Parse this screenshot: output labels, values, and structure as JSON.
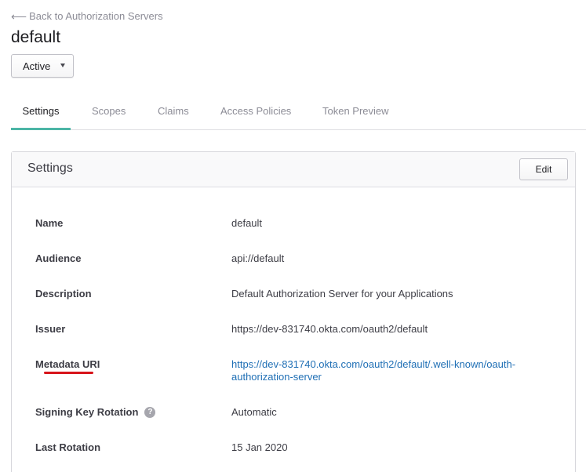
{
  "nav": {
    "back_arrow": "⟵",
    "back_label": "Back to Authorization Servers"
  },
  "page": {
    "title": "default"
  },
  "status": {
    "selected": "Active"
  },
  "tabs": [
    {
      "label": "Settings",
      "active": true
    },
    {
      "label": "Scopes",
      "active": false
    },
    {
      "label": "Claims",
      "active": false
    },
    {
      "label": "Access Policies",
      "active": false
    },
    {
      "label": "Token Preview",
      "active": false
    }
  ],
  "panel": {
    "title": "Settings",
    "edit_label": "Edit"
  },
  "fields": [
    {
      "label": "Name",
      "value": "default"
    },
    {
      "label": "Audience",
      "value": "api://default"
    },
    {
      "label": "Description",
      "value": "Default Authorization Server for your Applications"
    },
    {
      "label": "Issuer",
      "value": "https://dev-831740.okta.com/oauth2/default"
    },
    {
      "label": "Metadata URI",
      "value": "https://dev-831740.okta.com/oauth2/default/.well-known/oauth-authorization-server"
    },
    {
      "label": "Signing Key Rotation",
      "value": "Automatic",
      "help": "?"
    },
    {
      "label": "Last Rotation",
      "value": "15 Jan 2020"
    }
  ],
  "colors": {
    "accent": "#4cb5a6",
    "link": "#1f6fb5",
    "annotation": "#d7141a"
  }
}
